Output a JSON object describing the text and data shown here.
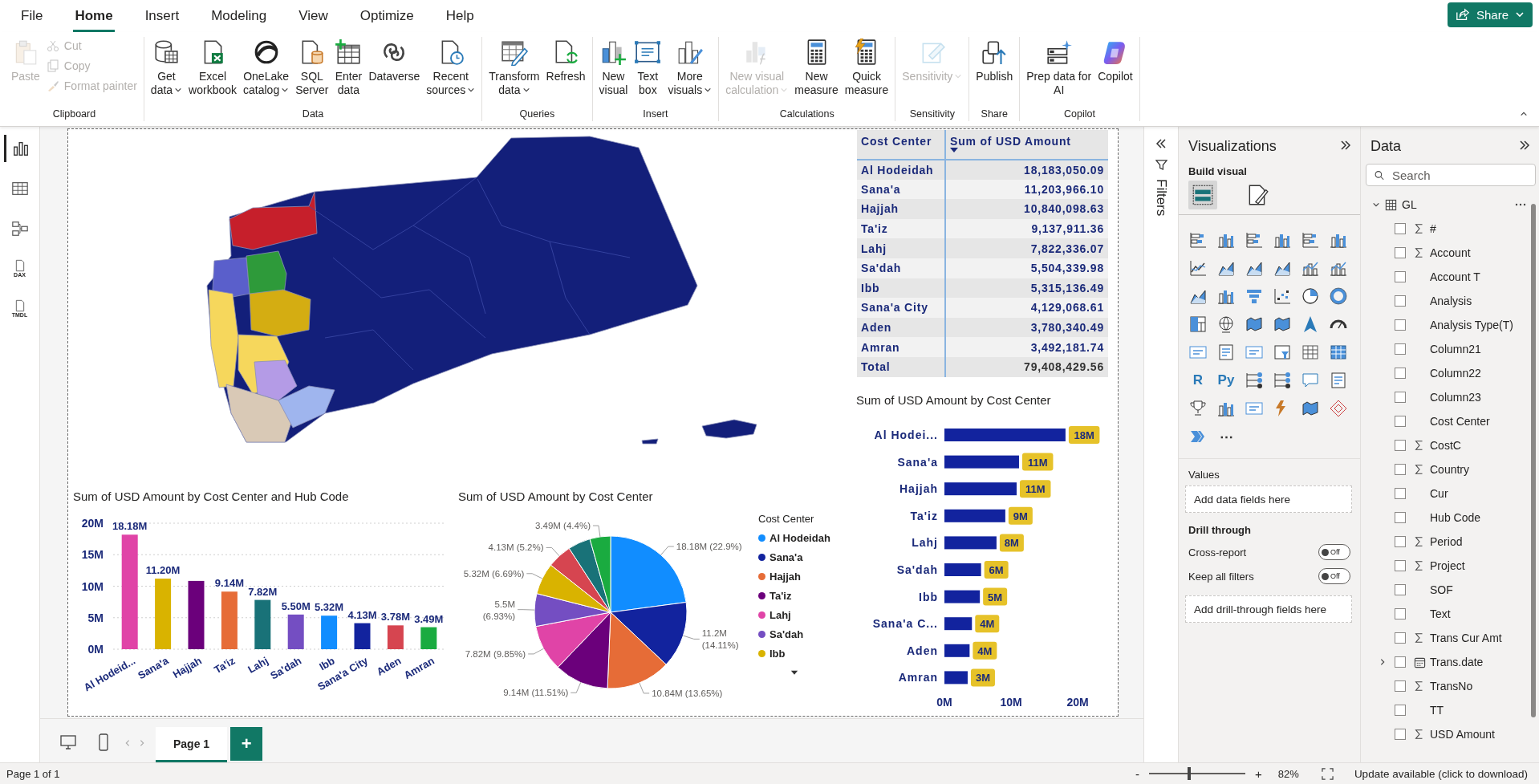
{
  "menu": {
    "tabs": [
      {
        "label": "File",
        "selected": false
      },
      {
        "label": "Home",
        "selected": true
      },
      {
        "label": "Insert",
        "selected": false
      },
      {
        "label": "Modeling",
        "selected": false
      },
      {
        "label": "View",
        "selected": false
      },
      {
        "label": "Optimize",
        "selected": false
      },
      {
        "label": "Help",
        "selected": false
      }
    ],
    "share": "Share"
  },
  "ribbon": {
    "groups": [
      {
        "label": "Clipboard",
        "buttons": [
          {
            "kind": "large",
            "lines": [
              "Paste"
            ],
            "dropdown": false,
            "disabled": true
          },
          {
            "kind": "small",
            "lines": [
              "Cut"
            ],
            "dropdown": false,
            "disabled": true
          },
          {
            "kind": "small",
            "lines": [
              "Copy"
            ],
            "dropdown": false,
            "disabled": true
          },
          {
            "kind": "small",
            "lines": [
              "Format painter"
            ],
            "dropdown": false,
            "disabled": true
          }
        ]
      },
      {
        "label": "Data",
        "buttons": [
          {
            "kind": "large",
            "lines": [
              "Get",
              "data"
            ],
            "dropdown": true,
            "disabled": false
          },
          {
            "kind": "large",
            "lines": [
              "Excel",
              "workbook"
            ],
            "dropdown": false,
            "disabled": false
          },
          {
            "kind": "large",
            "lines": [
              "OneLake",
              "catalog"
            ],
            "dropdown": true,
            "disabled": false
          },
          {
            "kind": "large",
            "lines": [
              "SQL",
              "Server"
            ],
            "dropdown": false,
            "disabled": false
          },
          {
            "kind": "large",
            "lines": [
              "Enter",
              "data"
            ],
            "dropdown": false,
            "disabled": false
          },
          {
            "kind": "large",
            "lines": [
              "Dataverse"
            ],
            "dropdown": false,
            "disabled": false
          },
          {
            "kind": "large",
            "lines": [
              "Recent",
              "sources"
            ],
            "dropdown": true,
            "disabled": false
          }
        ]
      },
      {
        "label": "Queries",
        "buttons": [
          {
            "kind": "large",
            "lines": [
              "Transform",
              "data"
            ],
            "dropdown": true,
            "disabled": false
          },
          {
            "kind": "large",
            "lines": [
              "Refresh"
            ],
            "dropdown": false,
            "disabled": false
          }
        ]
      },
      {
        "label": "Insert",
        "buttons": [
          {
            "kind": "large",
            "lines": [
              "New",
              "visual"
            ],
            "dropdown": false,
            "disabled": false
          },
          {
            "kind": "large",
            "lines": [
              "Text",
              "box"
            ],
            "dropdown": false,
            "disabled": false
          },
          {
            "kind": "large",
            "lines": [
              "More",
              "visuals"
            ],
            "dropdown": true,
            "disabled": false
          }
        ]
      },
      {
        "label": "Calculations",
        "buttons": [
          {
            "kind": "large",
            "lines": [
              "New visual",
              "calculation"
            ],
            "dropdown": true,
            "disabled": true
          },
          {
            "kind": "large",
            "lines": [
              "New",
              "measure"
            ],
            "dropdown": false,
            "disabled": false
          },
          {
            "kind": "large",
            "lines": [
              "Quick",
              "measure"
            ],
            "dropdown": false,
            "disabled": false
          }
        ]
      },
      {
        "label": "Sensitivity",
        "buttons": [
          {
            "kind": "large",
            "lines": [
              "Sensitivity"
            ],
            "dropdown": true,
            "disabled": true
          }
        ]
      },
      {
        "label": "Share",
        "buttons": [
          {
            "kind": "large",
            "lines": [
              "Publish"
            ],
            "dropdown": false,
            "disabled": false
          }
        ]
      },
      {
        "label": "Copilot",
        "buttons": [
          {
            "kind": "large",
            "lines": [
              "Prep data for",
              "AI"
            ],
            "dropdown": false,
            "disabled": false
          },
          {
            "kind": "large",
            "lines": [
              "Copilot"
            ],
            "dropdown": false,
            "disabled": false
          }
        ]
      }
    ]
  },
  "views": [
    {
      "selected": true
    },
    {
      "selected": false
    },
    {
      "selected": false
    },
    {
      "selected": false,
      "label": "DAX"
    },
    {
      "selected": false,
      "label": "TMDL"
    }
  ],
  "table": {
    "columns": [
      {
        "label": "Cost Center",
        "sorted": false
      },
      {
        "label": "Sum of USD Amount",
        "sorted": true
      }
    ],
    "rows": [
      [
        "Al Hodeidah",
        "18,183,050.09"
      ],
      [
        "Sana'a",
        "11,203,966.10"
      ],
      [
        "Hajjah",
        "10,840,098.63"
      ],
      [
        "Ta'iz",
        "9,137,911.36"
      ],
      [
        "Lahj",
        "7,822,336.07"
      ],
      [
        "Sa'dah",
        "5,504,339.98"
      ],
      [
        "Ibb",
        "5,315,136.49"
      ],
      [
        "Sana'a City",
        "4,129,068.61"
      ],
      [
        "Aden",
        "3,780,340.49"
      ],
      [
        "Amran",
        "3,492,181.74"
      ]
    ],
    "total": [
      "Total",
      "79,408,429.56"
    ]
  },
  "column_chart": {
    "chart_data": {
      "type": "bar",
      "title": "Sum of USD Amount by Cost Center and Hub Code",
      "categories": [
        "Al Hodeid...",
        "Sana'a",
        "Hajjah",
        "Ta'iz",
        "Lahj",
        "Sa'dah",
        "Ibb",
        "Sana'a City",
        "Aden",
        "Amran"
      ],
      "grid": true,
      "series": [
        {
          "colors": [
            "#e044a7",
            "#d9b300",
            "#6b007b",
            "#e66c37",
            "#197278",
            "#744ec2",
            "#118dff",
            "#12239e",
            "#d64550",
            "#1aab40"
          ],
          "values": [
            18.18,
            11.2,
            10.84,
            9.14,
            7.82,
            5.5,
            5.32,
            4.13,
            3.78,
            3.49
          ]
        }
      ],
      "ylim": [
        0,
        20
      ],
      "yticks": [
        {
          "value": 0,
          "label": "0M"
        },
        {
          "value": 5,
          "label": "5M"
        },
        {
          "value": 10,
          "label": "10M"
        },
        {
          "value": 15,
          "label": "15M"
        },
        {
          "value": 20,
          "label": "20M"
        }
      ],
      "value_labels": [
        "18.18M",
        "11.20M",
        null,
        "9.14M",
        "7.82M",
        "5.50M",
        "5.32M",
        "4.13M",
        "3.78M",
        "3.49M"
      ]
    }
  },
  "pie_chart": {
    "chart_data": {
      "type": "pie",
      "title": "Sum of USD Amount by Cost Center",
      "values": [
        22.9,
        14.11,
        13.65,
        11.51,
        9.85,
        6.93,
        6.69,
        5.2,
        4.76,
        4.4
      ],
      "colors": [
        "#118dff",
        "#12239e",
        "#e66c37",
        "#6b007b",
        "#e044a7",
        "#744ec2",
        "#d9b300",
        "#d64550",
        "#197278",
        "#1aab40"
      ],
      "value_labels": [
        "18.18M (22.9%)",
        "11.2M (14.11%)",
        "10.84M (13.65%)",
        "9.14M (11.51%)",
        "7.82M (9.85%)",
        "5.5M (6.93%)",
        "5.32M (6.69%)",
        "4.13M (5.2%)",
        null,
        "3.49M (4.4%)"
      ]
    },
    "legend": {
      "title": "Cost Center",
      "items": [
        {
          "label": "Al Hodeidah",
          "color": "#118dff"
        },
        {
          "label": "Sana'a",
          "color": "#12239e"
        },
        {
          "label": "Hajjah",
          "color": "#e66c37"
        },
        {
          "label": "Ta'iz",
          "color": "#6b007b"
        },
        {
          "label": "Lahj",
          "color": "#e044a7"
        },
        {
          "label": "Sa'dah",
          "color": "#744ec2"
        },
        {
          "label": "Ibb",
          "color": "#d9b300"
        }
      ]
    }
  },
  "bar_chart": {
    "chart_data": {
      "type": "bar",
      "orientation": "horizontal",
      "title": "Sum of USD Amount by Cost Center",
      "categories": [
        "Al Hodei...",
        "Sana'a",
        "Hajjah",
        "Ta'iz",
        "Lahj",
        "Sa'dah",
        "Ibb",
        "Sana'a C...",
        "Aden",
        "Amran"
      ],
      "series": [
        {
          "color": "#12239e",
          "values": [
            18.18,
            11.2,
            10.84,
            9.14,
            7.82,
            5.5,
            5.32,
            4.13,
            3.78,
            3.49
          ]
        }
      ],
      "xlim": [
        0,
        20
      ],
      "xticks": [
        {
          "value": 0,
          "label": "0M"
        },
        {
          "value": 10,
          "label": "10M"
        },
        {
          "value": 20,
          "label": "20M"
        }
      ],
      "value_labels": [
        "18M",
        "11M",
        "11M",
        "9M",
        "8M",
        "6M",
        "5M",
        "4M",
        "4M",
        "3M"
      ]
    }
  },
  "filters_pane": {
    "title": "Filters"
  },
  "visualizations_pane": {
    "title": "Visualizations",
    "section": "Build visual",
    "modes": [
      {
        "selected": true
      },
      {
        "selected": false
      }
    ],
    "glyphs": [
      "R",
      "Py"
    ],
    "more": "⋯",
    "values": {
      "label": "Values",
      "drop_hint": "Add data fields here"
    },
    "drill_through": {
      "title": "Drill through",
      "toggles": [
        {
          "label": "Cross-report",
          "on": false,
          "state": "Off"
        },
        {
          "label": "Keep all filters",
          "on": false,
          "state": "Off"
        }
      ],
      "drop_hint": "Add drill-through fields here"
    }
  },
  "data_pane": {
    "title": "Data",
    "search": {
      "placeholder": "Search"
    },
    "tables": [
      {
        "label": "GL",
        "expanded": true,
        "fields": [
          {
            "label": "#",
            "kind": "numeric",
            "checked": false
          },
          {
            "label": "Account",
            "kind": "numeric",
            "checked": false
          },
          {
            "label": "Account T",
            "kind": "text",
            "checked": false
          },
          {
            "label": "Analysis",
            "kind": "text",
            "checked": false
          },
          {
            "label": "Analysis Type(T)",
            "kind": "text",
            "checked": false
          },
          {
            "label": "Column21",
            "kind": "text",
            "checked": false
          },
          {
            "label": "Column22",
            "kind": "text",
            "checked": false
          },
          {
            "label": "Column23",
            "kind": "text",
            "checked": false
          },
          {
            "label": "Cost Center",
            "kind": "text",
            "checked": false
          },
          {
            "label": "CostC",
            "kind": "numeric",
            "checked": false
          },
          {
            "label": "Country",
            "kind": "numeric",
            "checked": false
          },
          {
            "label": "Cur",
            "kind": "text",
            "checked": false
          },
          {
            "label": "Hub Code",
            "kind": "text",
            "checked": false
          },
          {
            "label": "Period",
            "kind": "numeric",
            "checked": false
          },
          {
            "label": "Project",
            "kind": "numeric",
            "checked": false
          },
          {
            "label": "SOF",
            "kind": "text",
            "checked": false
          },
          {
            "label": "Text",
            "kind": "text",
            "checked": false
          },
          {
            "label": "Trans Cur Amt",
            "kind": "numeric",
            "checked": false
          },
          {
            "label": "Trans.date",
            "kind": "date",
            "checked": false
          },
          {
            "label": "TransNo",
            "kind": "numeric",
            "checked": false
          },
          {
            "label": "TT",
            "kind": "text",
            "checked": false
          },
          {
            "label": "USD Amount",
            "kind": "numeric",
            "checked": false
          }
        ]
      }
    ]
  },
  "page_tabs": {
    "pages": [
      {
        "label": "Page 1",
        "selected": true
      }
    ],
    "add": "+"
  },
  "status_bar": {
    "page": "Page 1 of 1",
    "zoom": {
      "minus": "-",
      "plus": "+",
      "level": 0.41,
      "reading": "82%"
    },
    "update": "Update available (click to download)"
  }
}
